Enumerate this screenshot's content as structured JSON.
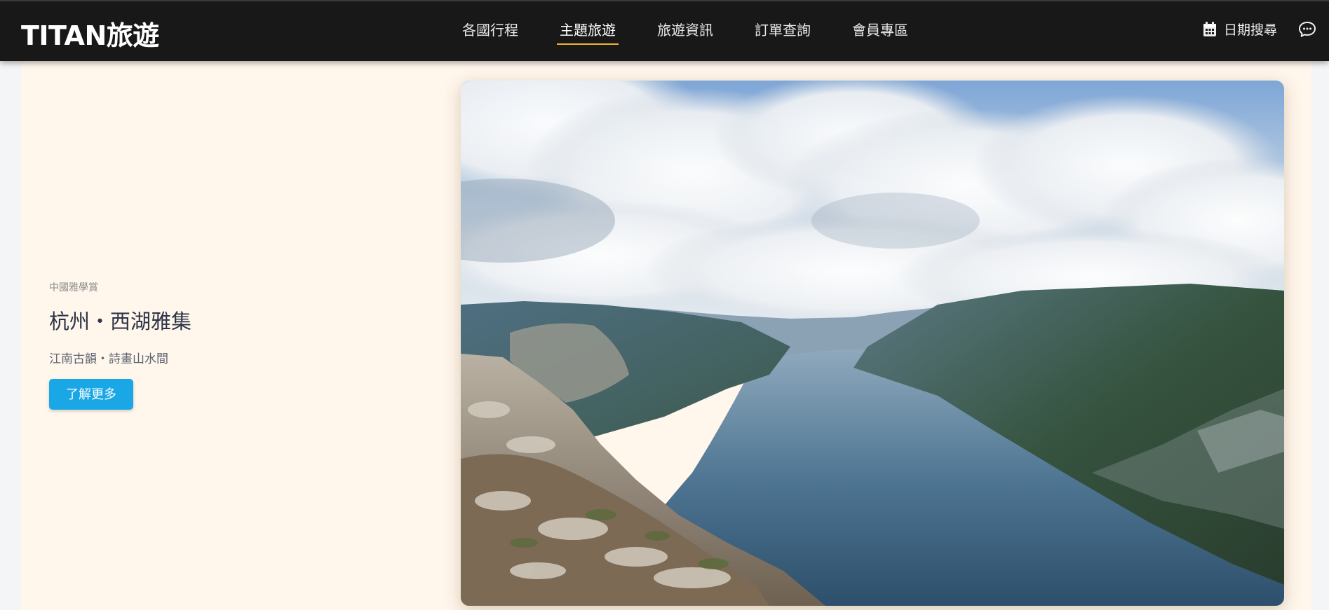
{
  "brand": {
    "name": "TITAN旅遊"
  },
  "nav": {
    "items": [
      {
        "label": "各國行程",
        "active": false
      },
      {
        "label": "主題旅遊",
        "active": true
      },
      {
        "label": "旅遊資訊",
        "active": false
      },
      {
        "label": "訂單查詢",
        "active": false
      },
      {
        "label": "會員專區",
        "active": false
      }
    ]
  },
  "tools": {
    "date_search_label": "日期搜尋",
    "date_icon": "calendar-icon",
    "chat_icon": "chat-bubble-icon"
  },
  "hero": {
    "eyebrow": "中國雅學賞",
    "title": "杭州・西湖雅集",
    "subtitle": "江南古韻・詩畫山水間",
    "cta_label": "了解更多",
    "image_subject": "fjord-mountain-landscape"
  },
  "colors": {
    "topbar_bg": "#181818",
    "active_underline": "#f0b429",
    "hero_bg": "#fff6ec",
    "cta_bg": "#1aa7e6"
  }
}
